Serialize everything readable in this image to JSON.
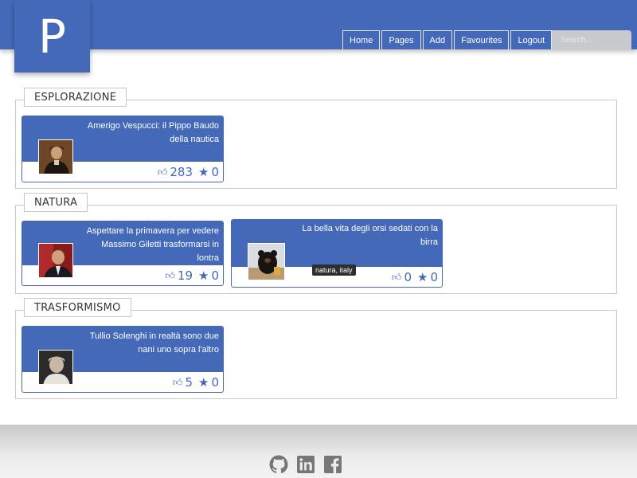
{
  "logo": "P",
  "nav": {
    "home": "Home",
    "pages": "Pages",
    "add": "Add",
    "favourites": "Favourites",
    "logout": "Logout",
    "search_placeholder": "Search..."
  },
  "sections": [
    {
      "title": "ESPLORAZIONE",
      "cards": [
        {
          "title_lines": [
            "Amerigo Vespucci: il Pippo Baudo",
            "della nautica"
          ],
          "likes": "283",
          "favs": "0"
        }
      ]
    },
    {
      "title": "NATURA",
      "cards": [
        {
          "title_lines": [
            "Aspettare la primavera per vedere",
            "Massimo Giletti trasformarsi in",
            "lontra"
          ],
          "likes": "19",
          "favs": "0"
        },
        {
          "title_lines": [
            "La bella vita degli orsi sedati con la",
            "birra"
          ],
          "likes": "0",
          "favs": "0",
          "tooltip": "natura, italy"
        }
      ]
    },
    {
      "title": "TRASFORMISMO",
      "cards": [
        {
          "title_lines": [
            "Tullio Solenghi in realtà sono due",
            "nani uno sopra l'altro"
          ],
          "likes": "5",
          "favs": "0"
        }
      ]
    }
  ],
  "icons": {
    "like": "thumbs-up-icon",
    "fav": "star-icon",
    "footer": [
      "github-icon",
      "linkedin-icon",
      "facebook-icon"
    ]
  },
  "colors": {
    "primary": "#4469b8",
    "footer": "#e6e6e6"
  }
}
